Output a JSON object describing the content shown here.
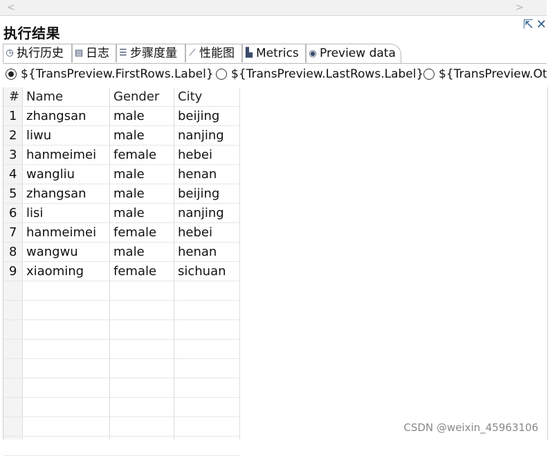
{
  "scrollbar": {
    "left_arrow": "<",
    "right_arrow": ">"
  },
  "panel": {
    "title": "执行结果"
  },
  "window_buttons": {
    "popout_icon": "⇱",
    "close_icon": "✕"
  },
  "tabs": [
    {
      "label": "执行历史",
      "icon": "clock-icon",
      "glyph": "◷"
    },
    {
      "label": "日志",
      "icon": "document-icon",
      "glyph": "▤"
    },
    {
      "label": "步骤度量",
      "icon": "list-numbered-icon",
      "glyph": "☰"
    },
    {
      "label": "性能图",
      "icon": "line-chart-icon",
      "glyph": "⟋"
    },
    {
      "label": "Metrics",
      "icon": "metrics-icon",
      "glyph": "▙"
    },
    {
      "label": "Preview data",
      "icon": "eye-icon",
      "glyph": "◉",
      "active": true
    }
  ],
  "preview_options": [
    {
      "label": "${TransPreview.FirstRows.Label}",
      "checked": true
    },
    {
      "label": "${TransPreview.LastRows.Label}",
      "checked": false
    },
    {
      "label": "${TransPreview.Ot",
      "checked": false
    }
  ],
  "table": {
    "headers": [
      "#",
      "Name",
      "Gender",
      "City"
    ],
    "rows": [
      [
        "1",
        "zhangsan",
        "male",
        "beijing"
      ],
      [
        "2",
        "liwu",
        "male",
        "nanjing"
      ],
      [
        "3",
        "hanmeimei",
        "female",
        "hebei"
      ],
      [
        "4",
        "wangliu",
        "male",
        "henan"
      ],
      [
        "5",
        "zhangsan",
        "male",
        "beijing"
      ],
      [
        "6",
        "lisi",
        "male",
        "nanjing"
      ],
      [
        "7",
        "hanmeimei",
        "female",
        "hebei"
      ],
      [
        "8",
        "wangwu",
        "male",
        "henan"
      ],
      [
        "9",
        "xiaoming",
        "female",
        "sichuan"
      ]
    ]
  },
  "watermark": "CSDN @weixin_45963106",
  "colors": {
    "accent": "#2b5d8c",
    "grid_line": "#dcdcdc",
    "tab_border": "#b9b9b9"
  }
}
